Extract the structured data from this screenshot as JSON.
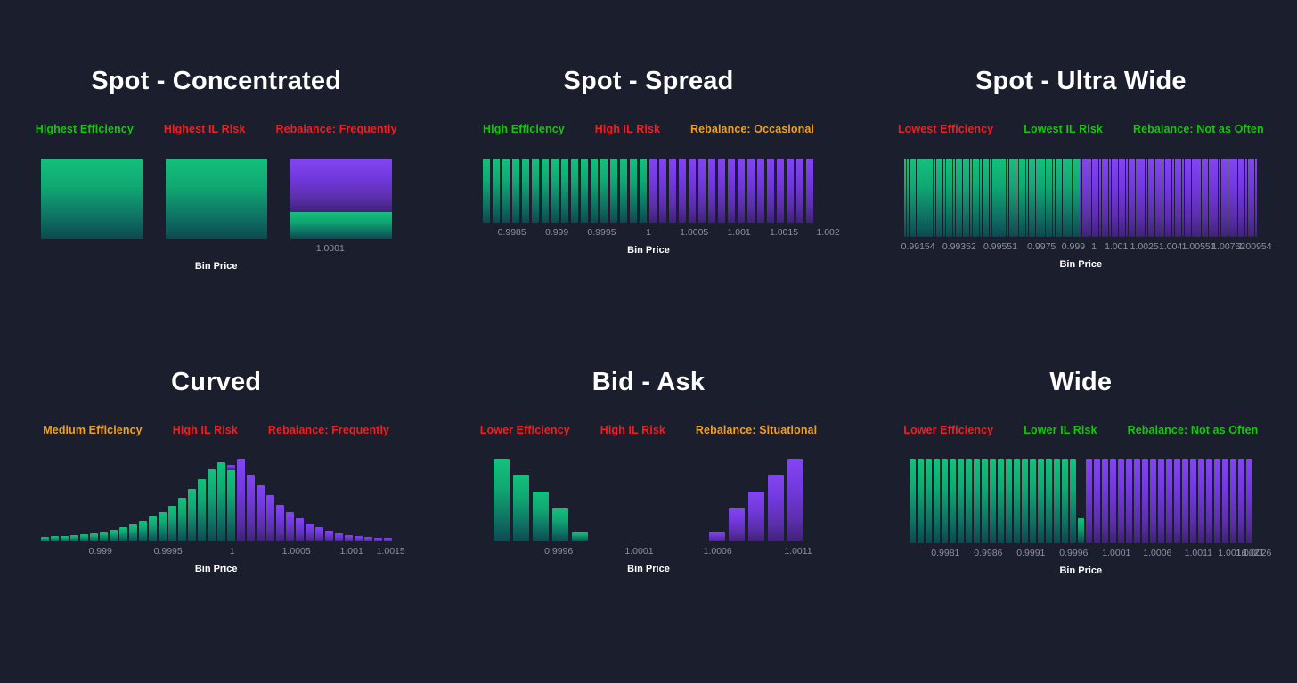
{
  "theme": {
    "background": "#1b1e2c",
    "green": "#14c07c",
    "purple": "#8246f0",
    "good": "#16c60c",
    "bad": "#f51d20",
    "warn": "#f0a020",
    "tick": "#8b90a4",
    "title": "#ffffff"
  },
  "axis_label": "Bin Price",
  "panels": [
    {
      "id": "spot-concentrated",
      "title": "Spot - Concentrated",
      "tags": [
        {
          "text": "Highest Efficiency",
          "color": "#16c60c"
        },
        {
          "text": "Highest IL Risk",
          "color": "#f51d20"
        },
        {
          "text": "Rebalance: Frequently",
          "color": "#f51d20"
        }
      ]
    },
    {
      "id": "spot-spread",
      "title": "Spot - Spread",
      "tags": [
        {
          "text": "High Efficiency",
          "color": "#16c60c"
        },
        {
          "text": "High IL Risk",
          "color": "#f51d20"
        },
        {
          "text": "Rebalance: Occasional",
          "color": "#f0a020"
        }
      ]
    },
    {
      "id": "spot-ultra-wide",
      "title": "Spot - Ultra Wide",
      "tags": [
        {
          "text": "Lowest Efficiency",
          "color": "#f51d20"
        },
        {
          "text": "Lowest IL Risk",
          "color": "#16c60c"
        },
        {
          "text": "Rebalance: Not as Often",
          "color": "#16c60c"
        }
      ]
    },
    {
      "id": "curved",
      "title": "Curved",
      "tags": [
        {
          "text": "Medium Efficiency",
          "color": "#f0a020"
        },
        {
          "text": "High IL Risk",
          "color": "#f51d20"
        },
        {
          "text": "Rebalance: Frequently",
          "color": "#f51d20"
        }
      ]
    },
    {
      "id": "bid-ask",
      "title": "Bid - Ask",
      "tags": [
        {
          "text": "Lower Efficiency",
          "color": "#f51d20"
        },
        {
          "text": "High IL Risk",
          "color": "#f51d20"
        },
        {
          "text": "Rebalance: Situational",
          "color": "#f0a020"
        }
      ]
    },
    {
      "id": "wide",
      "title": "Wide",
      "tags": [
        {
          "text": "Lower Efficiency",
          "color": "#f51d20"
        },
        {
          "text": "Lower IL Risk",
          "color": "#16c60c"
        },
        {
          "text": "Rebalance: Not as Often",
          "color": "#16c60c"
        }
      ]
    }
  ],
  "chart_data": [
    {
      "id": "spot-concentrated",
      "type": "bar",
      "title": "Spot - Concentrated",
      "xlabel": "Bin Price",
      "ylabel": "",
      "grid": false,
      "legend": "none",
      "tick_labels": [
        "1.0001"
      ],
      "tick_positions_pct": [
        80.5
      ],
      "bars": [
        {
          "green": 100,
          "purple": 0
        },
        {
          "green": 100,
          "purple": 0
        },
        {
          "green": 33,
          "purple": 67
        }
      ]
    },
    {
      "id": "spot-spread",
      "type": "bar",
      "title": "Spot - Spread",
      "xlabel": "Bin Price",
      "grid": false,
      "legend": "none",
      "tick_labels": [
        "0.9985",
        "0.999",
        "0.9995",
        "1",
        "1.0005",
        "1.001",
        "1.0015",
        "1.002"
      ],
      "tick_positions_pct": [
        13.5,
        25.5,
        37.5,
        50,
        62.2,
        74.2,
        86.2,
        98
      ],
      "bar_count": 34,
      "green_count": 17,
      "values_uniform": 100
    },
    {
      "id": "spot-ultra-wide",
      "type": "bar",
      "title": "Spot - Ultra Wide",
      "xlabel": "Bin Price",
      "grid": false,
      "legend": "none",
      "tick_labels": [
        "0.99154",
        "0.99352",
        "0.99551",
        "0.9975",
        "0.999",
        "1",
        "1.001",
        "1.0025",
        "1.004",
        "1.00551",
        "1.00752",
        "1.00954"
      ],
      "tick_positions_pct": [
        6.5,
        17.5,
        28.5,
        39.5,
        48,
        53.5,
        59.5,
        67,
        74,
        81.5,
        89.5,
        96.5
      ],
      "bar_count": 145,
      "green_count": 72,
      "values_uniform": 100
    },
    {
      "id": "curved",
      "type": "bar",
      "title": "Curved",
      "xlabel": "Bin Price",
      "grid": false,
      "legend": "none",
      "tick_labels": [
        "0.999",
        "0.9995",
        "1",
        "1.0005",
        "1.001",
        "1.0015"
      ],
      "tick_positions_pct": [
        17.5,
        36.5,
        54.5,
        72.5,
        88,
        99
      ],
      "green_values": [
        5,
        6,
        7,
        8,
        9,
        10,
        12,
        14,
        17,
        21,
        25,
        30,
        36,
        44,
        53,
        64,
        76,
        88,
        97,
        93
      ],
      "purple_values": [
        100,
        82,
        68,
        56,
        45,
        36,
        28,
        22,
        17,
        13,
        10,
        8,
        6,
        5,
        4,
        4
      ],
      "green_cap_index": 19,
      "green_cap_purple": 6
    },
    {
      "id": "bid-ask",
      "type": "bar",
      "title": "Bid - Ask",
      "xlabel": "Bin Price",
      "grid": false,
      "legend": "none",
      "tick_labels": [
        "0.9996",
        "1.0001",
        "1.0006",
        "1.0011"
      ],
      "tick_positions_pct": [
        26,
        47.5,
        68.5,
        90
      ],
      "green_values": [
        100,
        81,
        61,
        40,
        12
      ],
      "purple_values": [
        12,
        40,
        61,
        81,
        100
      ]
    },
    {
      "id": "wide",
      "type": "bar",
      "title": "Wide",
      "xlabel": "Bin Price",
      "grid": false,
      "legend": "none",
      "tick_labels": [
        "0.9981",
        "0.9986",
        "0.9991",
        "0.9996",
        "1.0001",
        "1.0006",
        "1.0011",
        "1.0016",
        "1.0021",
        "1.0026"
      ],
      "tick_positions_pct": [
        12,
        24,
        36,
        48,
        60,
        71.5,
        83,
        92.5,
        97.5,
        99.5
      ],
      "bar_count": 43,
      "green_count": 21,
      "short_bar_index": 21,
      "short_bar_value": 30,
      "values_uniform": 100
    }
  ]
}
